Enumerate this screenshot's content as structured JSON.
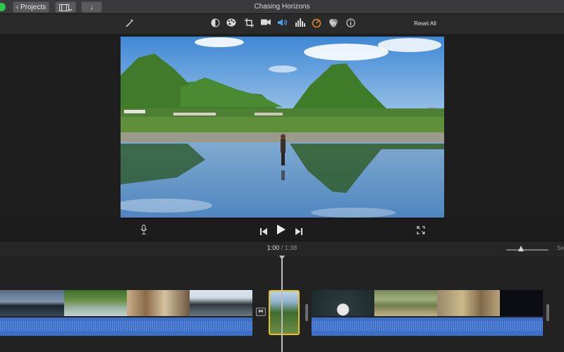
{
  "window": {
    "title": "Chasing Horizons"
  },
  "titlebar": {
    "projects_label": "Projects",
    "back_icon": "chevron-left-icon",
    "media_icon": "film-strip-icon",
    "import_icon": "down-arrow-icon"
  },
  "toolbar": {
    "tools": [
      "magic-wand-icon",
      "color-balance-icon",
      "color-palette-icon",
      "crop-icon",
      "camera-stabilization-icon",
      "volume-icon",
      "equalizer-icon",
      "speedometer-icon",
      "filter-icon",
      "info-icon"
    ],
    "reset_label": "Reset All"
  },
  "transport": {
    "voiceover_icon": "microphone-icon",
    "prev_icon": "skip-back-icon",
    "play_icon": "play-icon",
    "next_icon": "skip-forward-icon",
    "fullscreen_icon": "fullscreen-icon"
  },
  "timeline": {
    "current_time": "1:00",
    "separator": "/",
    "total_time": "1:38",
    "zoom_label": "Se",
    "transition_icon": "transition-icon"
  },
  "colors": {
    "accent_selected": "#e3c12c",
    "audio": "#3d6fc8",
    "traffic_green": "#2dc94a"
  }
}
